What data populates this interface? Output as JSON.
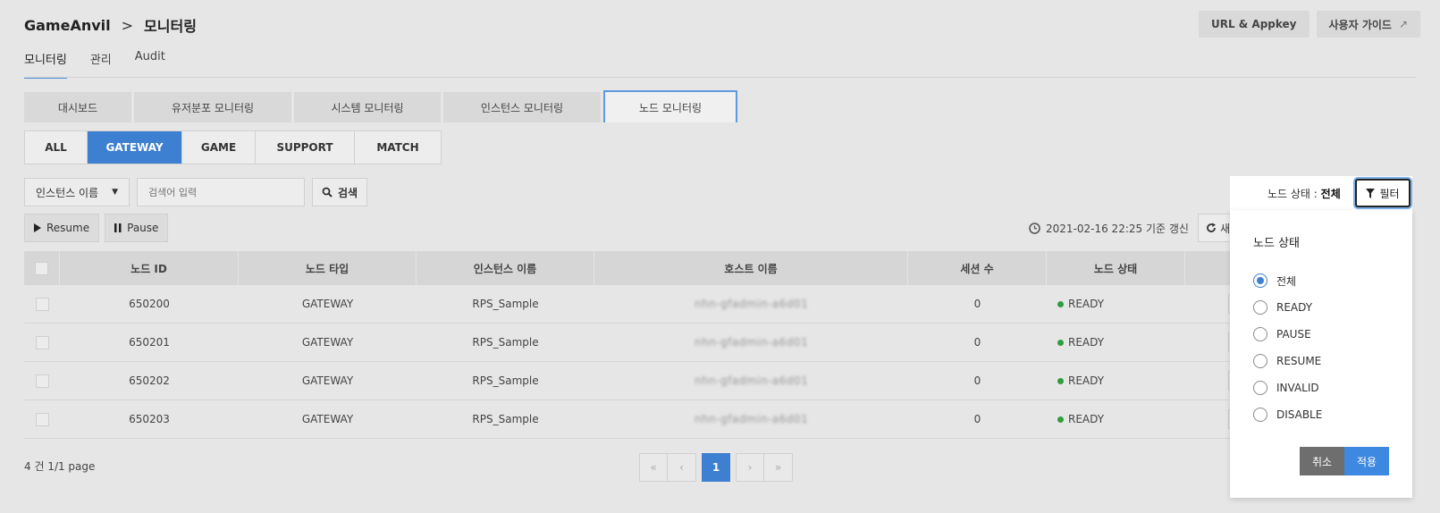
{
  "breadcrumb": {
    "root": "GameAnvil",
    "separator": ">",
    "current": "모니터링"
  },
  "top_buttons": {
    "url_appkey": "URL & Appkey",
    "user_guide": "사용자 가이드",
    "external_icon": "↗"
  },
  "main_tabs": [
    {
      "label": "모니터링",
      "active": true
    },
    {
      "label": "관리",
      "active": false
    },
    {
      "label": "Audit",
      "active": false
    }
  ],
  "sub_tabs": [
    {
      "label": "대시보드",
      "active": false
    },
    {
      "label": "유저분포 모니터링",
      "active": false
    },
    {
      "label": "시스템 모니터링",
      "active": false
    },
    {
      "label": "인스턴스 모니터링",
      "active": false
    },
    {
      "label": "노드 모니터링",
      "active": true
    }
  ],
  "type_tabs": [
    {
      "label": "ALL",
      "active": false
    },
    {
      "label": "GATEWAY",
      "active": true
    },
    {
      "label": "GAME",
      "active": false
    },
    {
      "label": "SUPPORT",
      "active": false
    },
    {
      "label": "MATCH",
      "active": false
    }
  ],
  "search": {
    "select_value": "인스턴스 이름",
    "placeholder": "검색어 입력",
    "button_label": "검색"
  },
  "actions": {
    "resume": "Resume",
    "pause": "Pause"
  },
  "refresh": {
    "timestamp": "2021-02-16 22:25 기준 갱신",
    "button_label": "새"
  },
  "table": {
    "headers": [
      "노드 ID",
      "노드 타입",
      "인스턴스 이름",
      "호스트 이름",
      "세션 수",
      "노드 상태"
    ],
    "rows": [
      {
        "node_id": "650200",
        "node_type": "GATEWAY",
        "instance": "RPS_Sample",
        "host": "nhn-gfadmin-a6d01",
        "sessions": "0",
        "status": "READY"
      },
      {
        "node_id": "650201",
        "node_type": "GATEWAY",
        "instance": "RPS_Sample",
        "host": "nhn-gfadmin-a6d01",
        "sessions": "0",
        "status": "READY"
      },
      {
        "node_id": "650202",
        "node_type": "GATEWAY",
        "instance": "RPS_Sample",
        "host": "nhn-gfadmin-a6d01",
        "sessions": "0",
        "status": "READY"
      },
      {
        "node_id": "650203",
        "node_type": "GATEWAY",
        "instance": "RPS_Sample",
        "host": "nhn-gfadmin-a6d01",
        "sessions": "0",
        "status": "READY"
      }
    ]
  },
  "pagination": {
    "summary": "4 건 1/1 page",
    "first": "«",
    "prev": "‹",
    "current": "1",
    "next": "›",
    "last": "»"
  },
  "filter": {
    "status_label": "노드 상태 : ",
    "status_value": "전체",
    "button_label": "필터",
    "panel_title": "노드 상태",
    "options": [
      {
        "label": "전체",
        "checked": true
      },
      {
        "label": "READY",
        "checked": false
      },
      {
        "label": "PAUSE",
        "checked": false
      },
      {
        "label": "RESUME",
        "checked": false
      },
      {
        "label": "INVALID",
        "checked": false
      },
      {
        "label": "DISABLE",
        "checked": false
      }
    ],
    "cancel": "취소",
    "apply": "적용"
  },
  "colors": {
    "accent": "#3d7fd0",
    "ready": "#2e9e3e",
    "apply": "#3d88e0",
    "cancel": "#6e6e6e"
  }
}
